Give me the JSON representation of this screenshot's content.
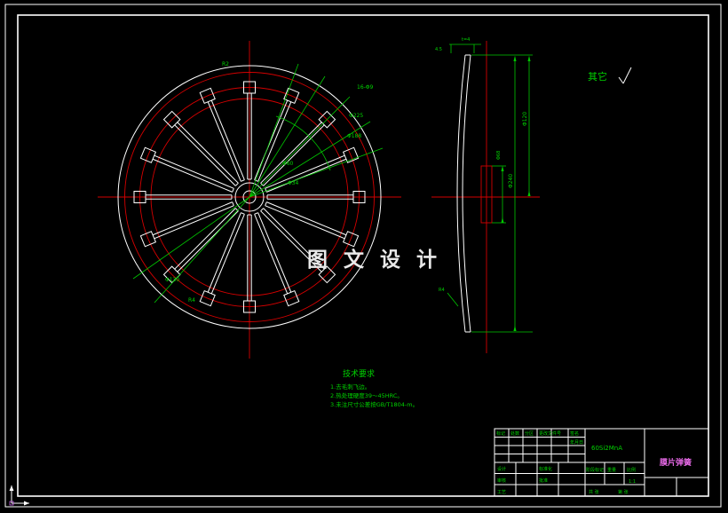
{
  "colors": {
    "background": "#000000",
    "geometry": "#ffffff",
    "centerline": "#d40000",
    "dimension": "#00c800",
    "part_name": "#e86ae8"
  },
  "watermark": "图 文 设 计",
  "other_note": "其它",
  "tech_notes": {
    "title": "技术要求",
    "items": [
      "1.去毛刺飞边。",
      "2.热处理硬度39～45HRC。",
      "3.未注尺寸公差按GB/T1804-m。"
    ]
  },
  "front_view": {
    "dims": [
      "R2",
      "16-Φ9",
      "Φ225",
      "Φ188",
      "Φ60",
      "Φ34",
      "Φ130",
      "R4"
    ]
  },
  "side_view": {
    "dims": [
      "4.5",
      "t=4",
      "Φ240",
      "Φ120",
      "Φ68",
      "R4"
    ]
  },
  "titleblock": {
    "material": "60Si2MnA",
    "part_name": "膜片弹簧",
    "scale": "1:1",
    "headers": [
      "标记",
      "处数",
      "分区",
      "更改文件号",
      "签名",
      "年月日"
    ],
    "rows": [
      "设计",
      "审核",
      "工艺",
      "标准化",
      "批准"
    ],
    "fields": [
      "阶段标记",
      "重量",
      "比例"
    ],
    "sheet": [
      "共 张",
      "第 张"
    ]
  }
}
